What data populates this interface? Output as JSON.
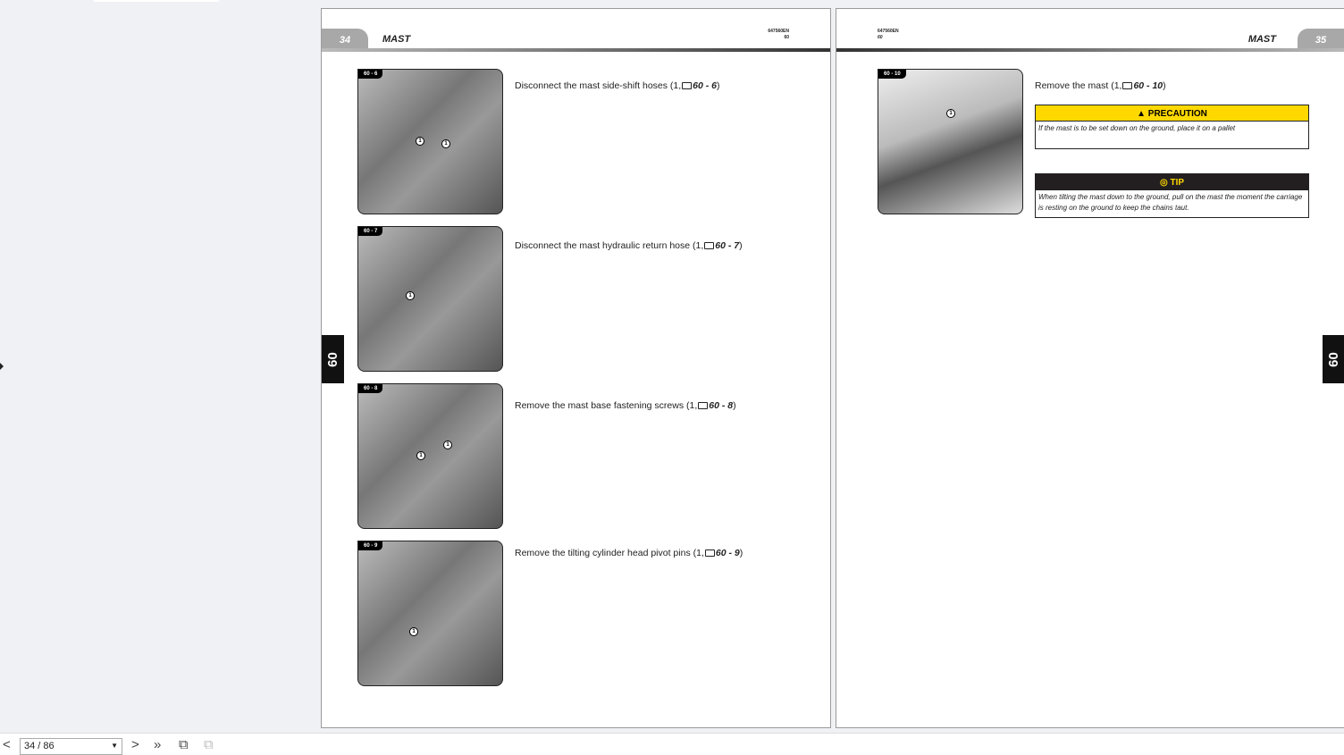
{
  "viewer": {
    "page_indicator": "34 / 86"
  },
  "left_page": {
    "number": "34",
    "title": "MAST",
    "doc_id": "647560EN",
    "section": "60",
    "side_tab": "60",
    "steps": [
      {
        "figure": "60 - 6",
        "text": "Disconnect the mast side-shift hoses (1,",
        "ref": "60 - 6",
        "callouts": [
          "1",
          "1"
        ]
      },
      {
        "figure": "60 - 7",
        "text": "Disconnect the mast hydraulic return hose (1,",
        "ref": "60 - 7",
        "callouts": [
          "1"
        ]
      },
      {
        "figure": "60 - 8",
        "text": "Remove the mast base fastening screws (1,",
        "ref": "60 - 8",
        "callouts": [
          "1",
          "1"
        ]
      },
      {
        "figure": "60 - 9",
        "text": "Remove the tilting cylinder head pivot pins (1,",
        "ref": "60 - 9",
        "callouts": [
          "1"
        ]
      }
    ]
  },
  "right_page": {
    "number": "35",
    "title": "MAST",
    "doc_id": "647560EN",
    "section": "60",
    "side_tab": "60",
    "step": {
      "figure": "60 - 10",
      "text": "Remove the mast (1,",
      "ref": "60 - 10",
      "callout": "1"
    },
    "precaution": {
      "title": "PRECAUTION",
      "text": "If the mast is to be set down on the ground, place it on a pallet",
      "color": "#ffd800"
    },
    "tip": {
      "title": "TIP",
      "text": "When tilting the mast down to the ground, pull on the mast the moment the carriage is resting on the ground to keep the chains taut."
    }
  }
}
